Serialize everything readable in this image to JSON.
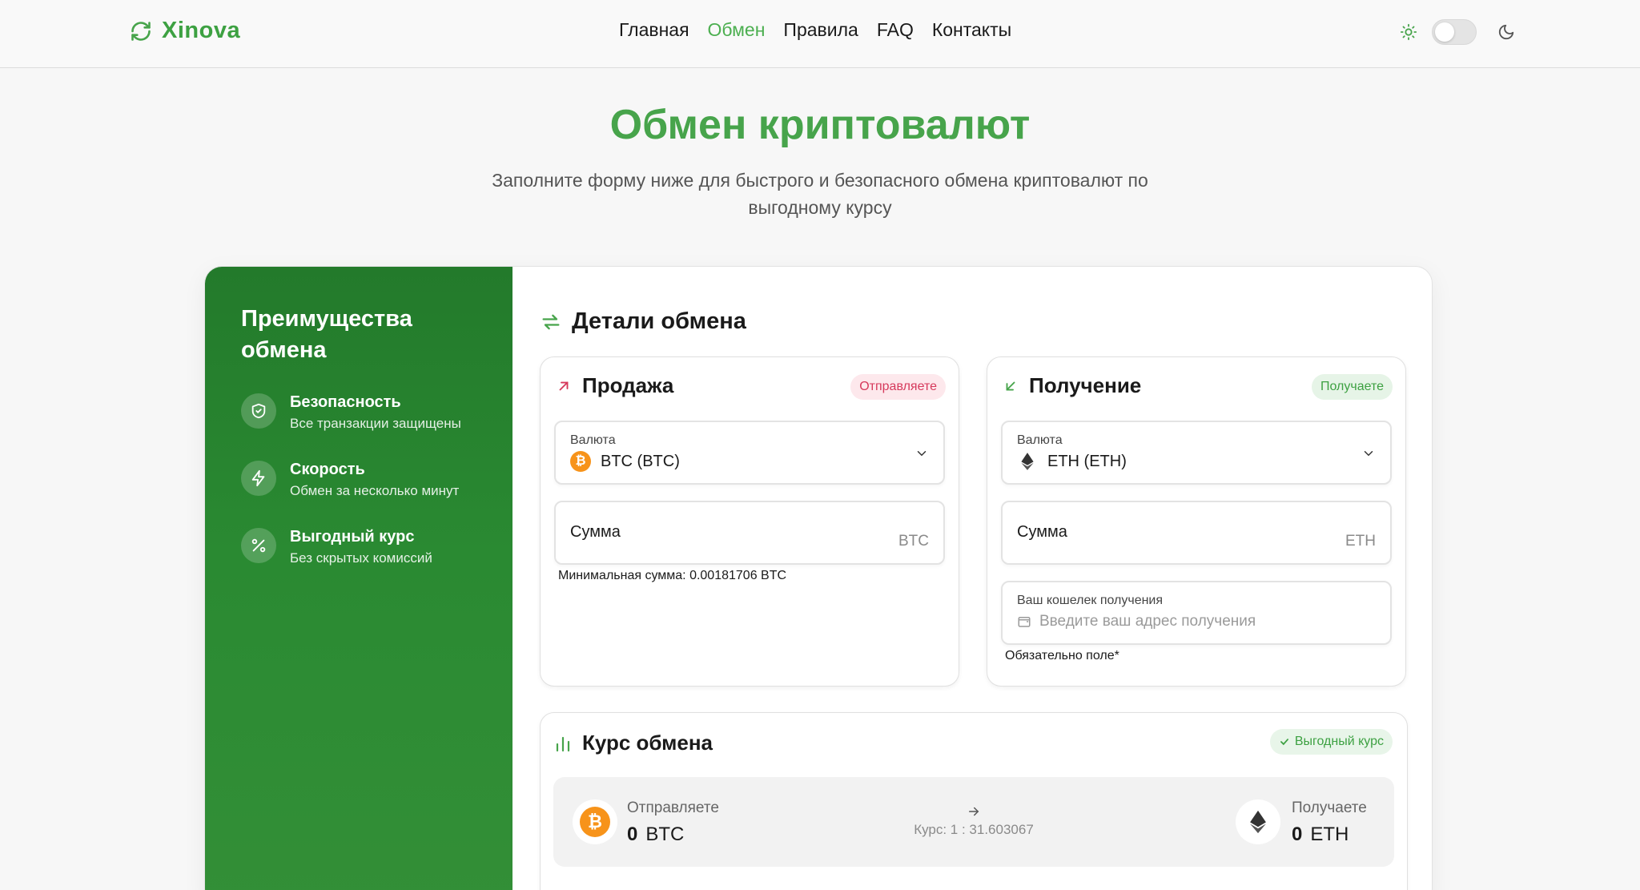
{
  "header": {
    "logo_text": "Xinova",
    "nav": [
      "Главная",
      "Обмен",
      "Правила",
      "FAQ",
      "Контакты"
    ],
    "active_nav": "Обмен"
  },
  "hero": {
    "title": "Обмен криптовалют",
    "subtitle": "Заполните форму ниже для быстрого и безопасного обмена криптовалют по выгодному курсу"
  },
  "sidebar": {
    "title": "Преимущества обмена",
    "items": [
      {
        "title": "Безопасность",
        "desc": "Все транзакции защищены",
        "icon": "shield-icon"
      },
      {
        "title": "Скорость",
        "desc": "Обмен за несколько минут",
        "icon": "lightning-icon"
      },
      {
        "title": "Выгодный курс",
        "desc": "Без скрытых комиссий",
        "icon": "percent-icon"
      }
    ]
  },
  "details": {
    "title": "Детали обмена",
    "sell": {
      "title": "Продажа",
      "badge": "Отправляете",
      "currency_label": "Валюта",
      "currency_value": "BTC (BTC)",
      "amount_label": "Сумма",
      "amount_unit": "BTC",
      "note": "Минимальная сумма: 0.00181706 BTC"
    },
    "receive": {
      "title": "Получение",
      "badge": "Получаете",
      "currency_label": "Валюта",
      "currency_value": "ETH (ETH)",
      "amount_label": "Сумма",
      "amount_unit": "ETH",
      "wallet_label": "Ваш кошелек получения",
      "wallet_placeholder": "Введите ваш адрес получения",
      "note": "Обязательно поле*"
    }
  },
  "rate": {
    "title": "Курс обмена",
    "badge": "Выгодный курс",
    "send_label": "Отправляете",
    "send_amount": "0",
    "send_unit": "BTC",
    "rate_text": "Курс: 1 : 31.603067",
    "recv_label": "Получаете",
    "recv_amount": "0",
    "recv_unit": "ETH"
  },
  "colors": {
    "brand": "#47a44b",
    "sidebar": "#2a8a32",
    "send_badge": "#d63a5c",
    "btc": "#f7931a"
  }
}
